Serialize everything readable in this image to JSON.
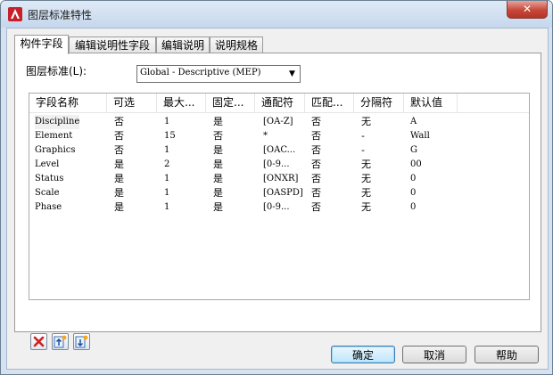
{
  "window": {
    "title": "图层标准特性",
    "close_label": "✕"
  },
  "tabs": [
    {
      "label": "构件字段",
      "active": true
    },
    {
      "label": "编辑说明性字段",
      "active": false
    },
    {
      "label": "编辑说明",
      "active": false
    },
    {
      "label": "说明规格",
      "active": false
    }
  ],
  "layer_standard": {
    "label": "图层标准(L):",
    "value": "Global - Descriptive (MEP)"
  },
  "table": {
    "columns": [
      "字段名称",
      "可选",
      "最大...",
      "固定...",
      "通配符",
      "匹配...",
      "分隔符",
      "默认值"
    ],
    "rows": [
      [
        "Discipline",
        "否",
        "1",
        "是",
        "[OA-Z]",
        "否",
        "无",
        "A"
      ],
      [
        "Element",
        "否",
        "15",
        "否",
        "*",
        "否",
        "-",
        "Wall"
      ],
      [
        "Graphics",
        "否",
        "1",
        "是",
        "[OAC...",
        "否",
        "-",
        "G"
      ],
      [
        "Level",
        "是",
        "2",
        "是",
        "[0-9...",
        "否",
        "无",
        "00"
      ],
      [
        "Status",
        "是",
        "1",
        "是",
        "[ONXR]",
        "否",
        "无",
        "0"
      ],
      [
        "Scale",
        "是",
        "1",
        "是",
        "[OASPD]",
        "否",
        "无",
        "0"
      ],
      [
        "Phase",
        "是",
        "1",
        "是",
        "[0-9...",
        "否",
        "无",
        "0"
      ]
    ]
  },
  "toolbar_icons": [
    "delete-field-icon",
    "move-up-icon",
    "move-down-icon"
  ],
  "buttons": {
    "ok": "确定",
    "cancel": "取消",
    "help": "帮助"
  },
  "colors": {
    "title_bg": "#c6d7ec",
    "close_red": "#c7483a",
    "default_btn": "#bee6fd"
  }
}
